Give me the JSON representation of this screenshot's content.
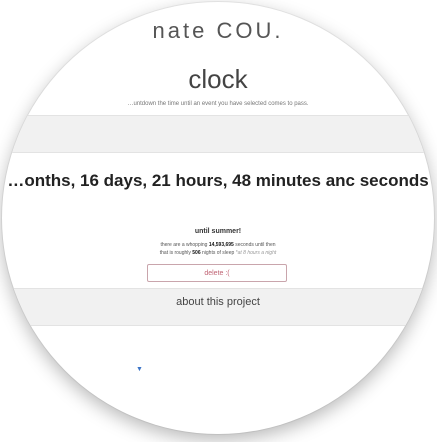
{
  "header": {
    "headline_partial": "nate COU.",
    "title": "clock",
    "intro": "…untdown the time until an event you have selected comes to pass."
  },
  "countdown": {
    "main": "…onths, 16 days, 21 hours, 48 minutes anc seconds",
    "until_label": "until summer!",
    "detail_prefix": "there are a whopping ",
    "seconds_value": "14,593,695",
    "detail_suffix": " seconds until then",
    "sleep_prefix": "that is roughly ",
    "sleep_nights": "506",
    "sleep_middle": " nights of sleep ",
    "sleep_note": "*at 8 hours a night"
  },
  "actions": {
    "delete_label": "delete :(",
    "about_label": "about this project"
  },
  "colors": {
    "delete_accent": "#c06474",
    "caret_blue": "#3b74c7"
  },
  "icons": {
    "caret": "caret-down-icon"
  }
}
